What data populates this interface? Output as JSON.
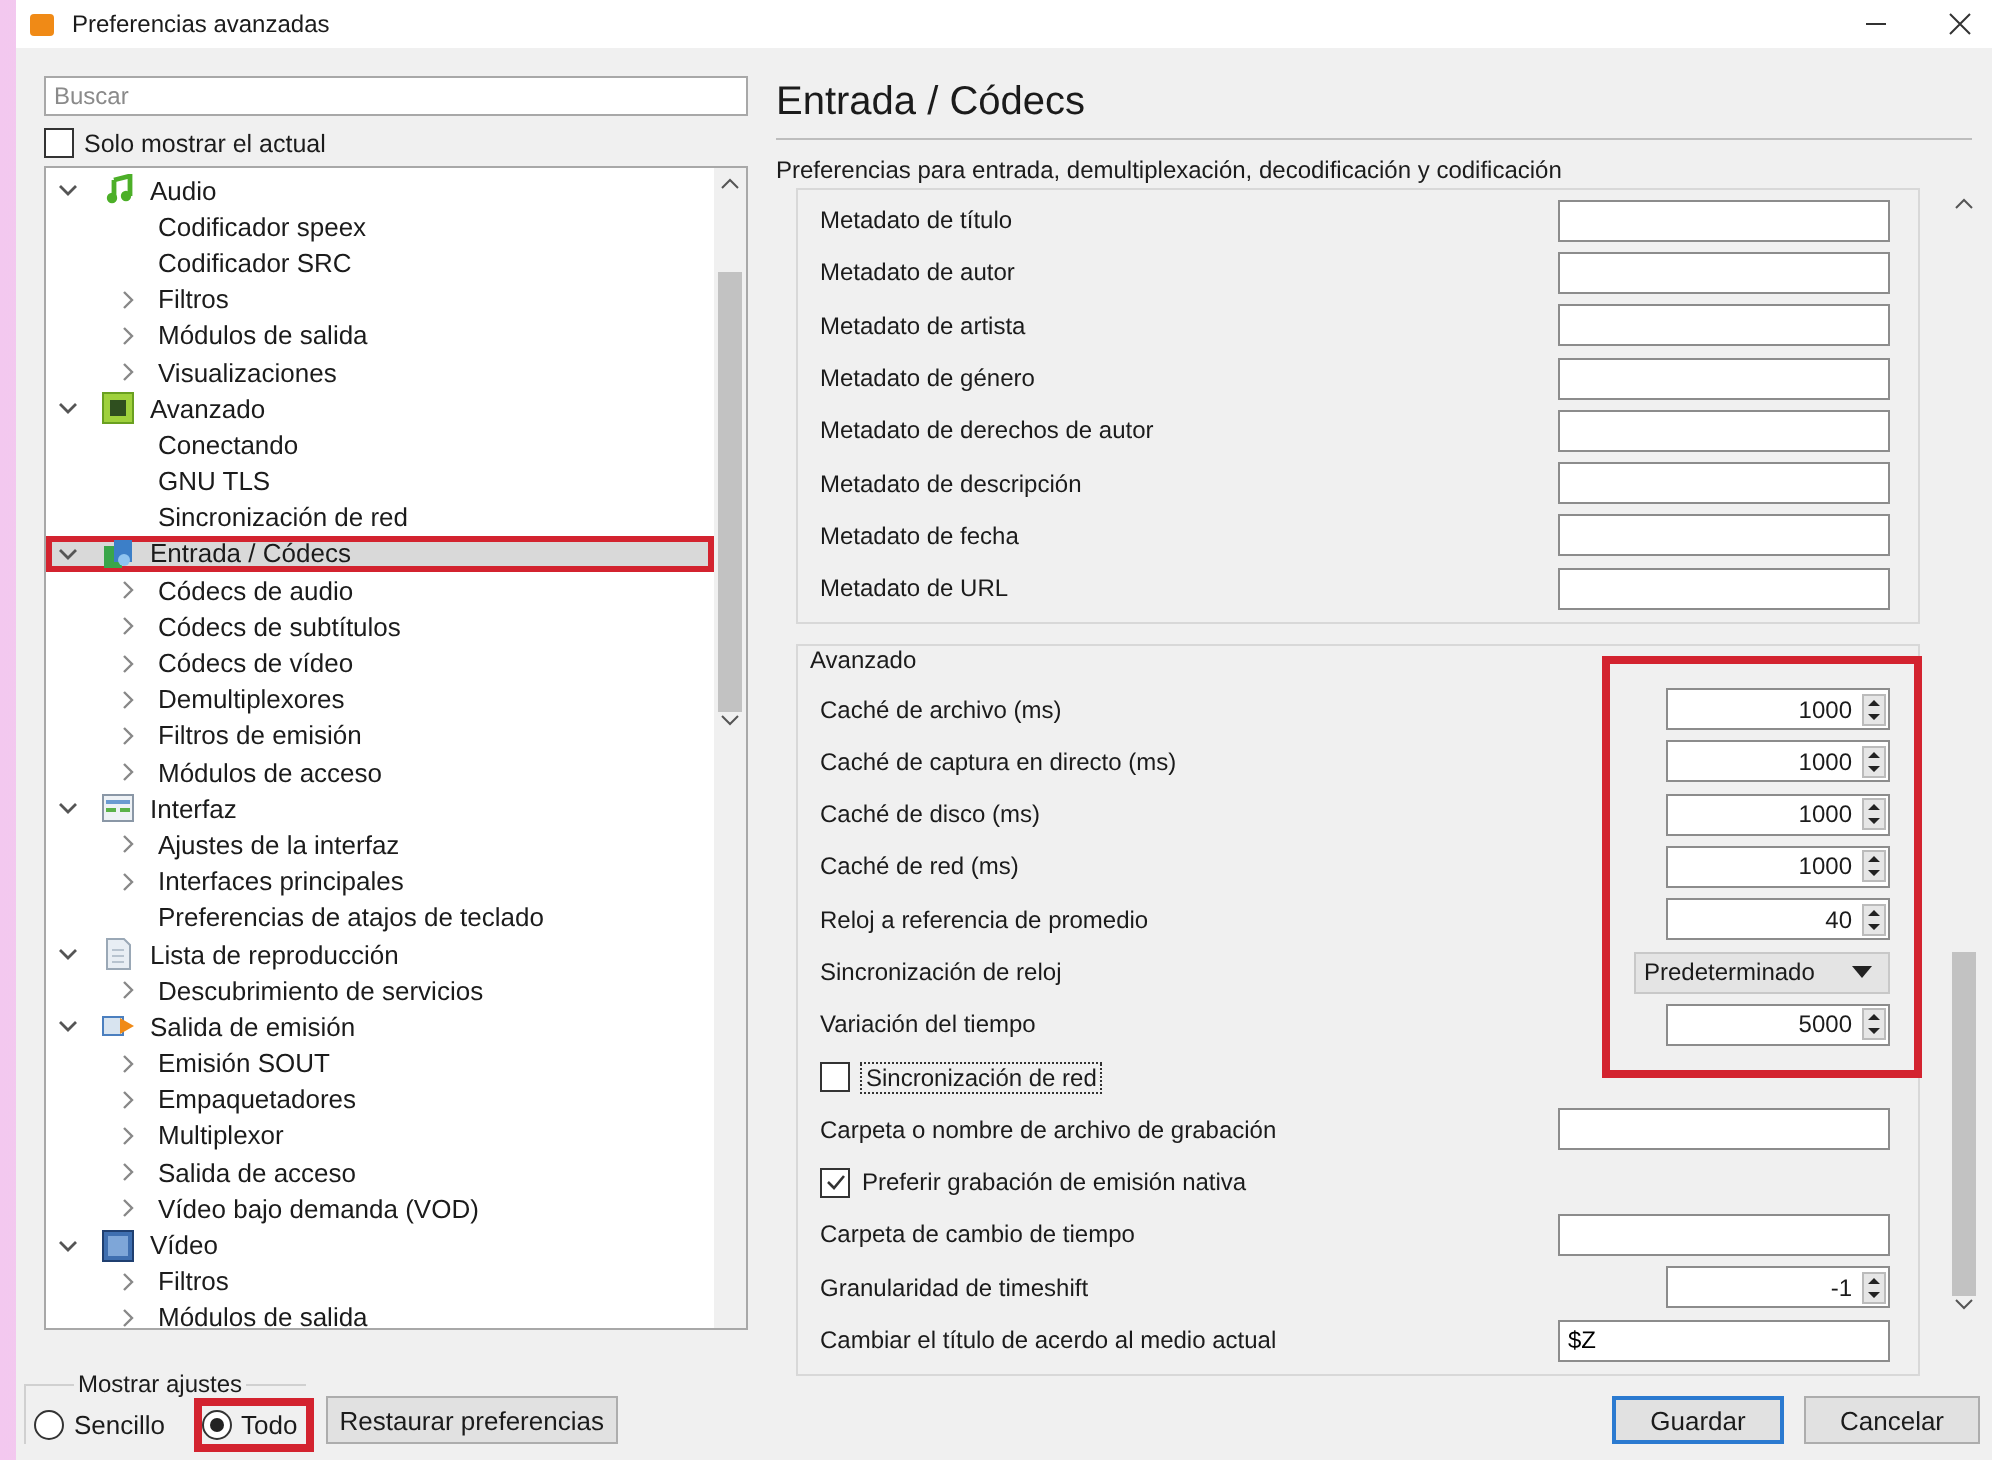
{
  "window": {
    "title": "Preferencias avanzadas"
  },
  "sidebar": {
    "search": {
      "placeholder": "Buscar"
    },
    "only_current": {
      "label": "Solo mostrar el actual",
      "checked": false
    },
    "tree": [
      {
        "label": "Audio",
        "kind": "audio",
        "expanded": true,
        "selected": false,
        "highlighted": false,
        "children": [
          {
            "label": "Codificador speex",
            "kind": "leaf",
            "selected": false,
            "highlighted": false
          },
          {
            "label": "Codificador SRC",
            "kind": "leaf",
            "selected": false,
            "highlighted": false
          },
          {
            "label": "Filtros",
            "kind": "branch",
            "expanded": false,
            "selected": false,
            "highlighted": false
          },
          {
            "label": "Módulos de salida",
            "kind": "branch",
            "expanded": false,
            "selected": false,
            "highlighted": false
          },
          {
            "label": "Visualizaciones",
            "kind": "branch",
            "expanded": false,
            "selected": false,
            "highlighted": false
          }
        ]
      },
      {
        "label": "Avanzado",
        "kind": "advanced",
        "expanded": true,
        "selected": false,
        "highlighted": false,
        "children": [
          {
            "label": "Conectando",
            "kind": "leaf",
            "selected": false,
            "highlighted": false
          },
          {
            "label": "GNU TLS",
            "kind": "leaf",
            "selected": false,
            "highlighted": false
          },
          {
            "label": "Sincronización de red",
            "kind": "leaf",
            "selected": false,
            "highlighted": false
          }
        ]
      },
      {
        "label": "Entrada / Códecs",
        "kind": "codecs",
        "expanded": true,
        "selected": true,
        "highlighted": true,
        "children": [
          {
            "label": "Códecs de audio",
            "kind": "branch",
            "expanded": false,
            "selected": false,
            "highlighted": false
          },
          {
            "label": "Códecs de subtítulos",
            "kind": "branch",
            "expanded": false,
            "selected": false,
            "highlighted": false
          },
          {
            "label": "Códecs de vídeo",
            "kind": "branch",
            "expanded": false,
            "selected": false,
            "highlighted": false
          },
          {
            "label": "Demultiplexores",
            "kind": "branch",
            "expanded": false,
            "selected": false,
            "highlighted": false
          },
          {
            "label": "Filtros de emisión",
            "kind": "branch",
            "expanded": false,
            "selected": false,
            "highlighted": false
          },
          {
            "label": "Módulos de acceso",
            "kind": "branch",
            "expanded": false,
            "selected": false,
            "highlighted": false
          }
        ]
      },
      {
        "label": "Interfaz",
        "kind": "interface",
        "expanded": true,
        "selected": false,
        "highlighted": false,
        "children": [
          {
            "label": "Ajustes de la interfaz",
            "kind": "branch",
            "expanded": false,
            "selected": false,
            "highlighted": false
          },
          {
            "label": "Interfaces principales",
            "kind": "branch",
            "expanded": false,
            "selected": false,
            "highlighted": false
          },
          {
            "label": "Preferencias de atajos de teclado",
            "kind": "leaf",
            "selected": false,
            "highlighted": false
          }
        ]
      },
      {
        "label": "Lista de reproducción",
        "kind": "playlist",
        "expanded": true,
        "selected": false,
        "highlighted": false,
        "children": [
          {
            "label": "Descubrimiento de servicios",
            "kind": "branch",
            "expanded": false,
            "selected": false,
            "highlighted": false
          }
        ]
      },
      {
        "label": "Salida de emisión",
        "kind": "stream",
        "expanded": true,
        "selected": false,
        "highlighted": false,
        "children": [
          {
            "label": "Emisión SOUT",
            "kind": "branch",
            "expanded": false,
            "selected": false,
            "highlighted": false
          },
          {
            "label": "Empaquetadores",
            "kind": "branch",
            "expanded": false,
            "selected": false,
            "highlighted": false
          },
          {
            "label": "Multiplexor",
            "kind": "branch",
            "expanded": false,
            "selected": false,
            "highlighted": false
          },
          {
            "label": "Salida de acceso",
            "kind": "branch",
            "expanded": false,
            "selected": false,
            "highlighted": false
          },
          {
            "label": "Vídeo bajo demanda (VOD)",
            "kind": "branch",
            "expanded": false,
            "selected": false,
            "highlighted": false
          }
        ]
      },
      {
        "label": "Vídeo",
        "kind": "video",
        "expanded": true,
        "selected": false,
        "highlighted": false,
        "children": [
          {
            "label": "Filtros",
            "kind": "branch",
            "expanded": false,
            "selected": false,
            "highlighted": false
          },
          {
            "label": "Módulos de salida",
            "kind": "branch",
            "expanded": false,
            "selected": false,
            "highlighted": false
          }
        ]
      }
    ]
  },
  "panel": {
    "title": "Entrada / Códecs",
    "description": "Preferencias para entrada, demultiplexación, decodificación y codificación",
    "groups": [
      {
        "rows": [
          {
            "kind": "text",
            "label": "Metadato de título"
          },
          {
            "kind": "text",
            "label": "Metadato de autor"
          },
          {
            "kind": "text",
            "label": "Metadato de artista"
          },
          {
            "kind": "text",
            "label": "Metadato de género"
          },
          {
            "kind": "text",
            "label": "Metadato de derechos de autor"
          },
          {
            "kind": "text",
            "label": "Metadato de descripción"
          },
          {
            "kind": "text",
            "label": "Metadato de fecha"
          },
          {
            "kind": "text",
            "label": "Metadato de URL"
          }
        ]
      },
      {
        "title": "Avanzado",
        "highlighted_rows": [
          {
            "kind": "spin",
            "label": "Caché de archivo (ms)",
            "value": "1000"
          },
          {
            "kind": "spin",
            "label": "Caché de captura en directo (ms)",
            "value": "1000"
          },
          {
            "kind": "spin",
            "label": "Caché de disco (ms)",
            "value": "1000"
          },
          {
            "kind": "spin",
            "label": "Caché de red (ms)",
            "value": "1000"
          },
          {
            "kind": "spin",
            "label": "Reloj a referencia de promedio",
            "value": "40"
          },
          {
            "kind": "dropdown",
            "label": "Sincronización de reloj",
            "value": "Predeterminado"
          },
          {
            "kind": "spin",
            "label": "Variación del tiempo",
            "value": "5000"
          }
        ],
        "rows": [
          {
            "kind": "checkbox",
            "label": "Sincronización de red",
            "checked": false,
            "focused": true
          },
          {
            "kind": "text",
            "label": "Carpeta o nombre de archivo de grabación"
          },
          {
            "kind": "checkbox",
            "label": "Preferir grabación de emisión nativa",
            "checked": true,
            "focused": false
          },
          {
            "kind": "text",
            "label": "Carpeta de cambio de tiempo"
          },
          {
            "kind": "spin",
            "label": "Granularidad de timeshift",
            "value": "-1"
          },
          {
            "kind": "text",
            "label": "Cambiar el título de acerdo al medio actual",
            "value": "$Z"
          }
        ]
      }
    ]
  },
  "footer": {
    "show_settings": {
      "title": "Mostrar ajustes",
      "options": [
        {
          "label": "Sencillo",
          "selected": false
        }
      ],
      "highlighted_options": [
        {
          "label": "Todo",
          "selected": true
        }
      ]
    },
    "reset_button": "Restaurar preferencias",
    "buttons": [
      {
        "label": "Guardar",
        "default": true
      },
      {
        "label": "Cancelar",
        "default": false
      }
    ]
  }
}
